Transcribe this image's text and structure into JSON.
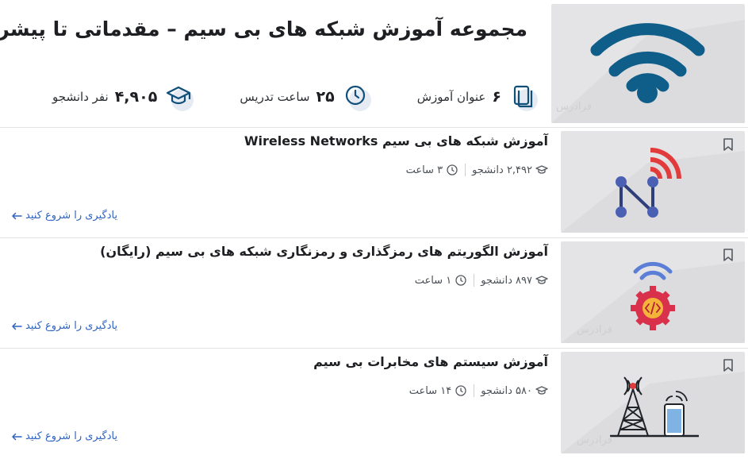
{
  "collection": {
    "title": "مجموعه آموزش شبکه های بی سیم – مقدماتی تا پیشرفته",
    "thumb_icon": "wifi-icon",
    "stats": [
      {
        "icon": "book-icon",
        "value": "۶",
        "label": "عنوان آموزش"
      },
      {
        "icon": "clock-icon",
        "value": "۲۵",
        "label": "ساعت تدریس"
      },
      {
        "icon": "graduation-cap-icon",
        "value": "۴,۹۰۵",
        "label": "نفر دانشجو"
      }
    ],
    "watermark": "فرادرس"
  },
  "courses": [
    {
      "title": "آموزش شبکه های بی سیم Wireless Networks",
      "students": "۲,۴۹۲ دانشجو",
      "hours": "۳ ساعت",
      "cta": "یادگیری را شروع کنید",
      "thumb_icon": "network-signal-icon"
    },
    {
      "title": "آموزش الگوریتم های رمزگذاری و رمزنگاری شبکه های بی سیم (رایگان)",
      "students": "۸۹۷ دانشجو",
      "hours": "۱ ساعت",
      "cta": "یادگیری را شروع کنید",
      "thumb_icon": "code-gear-icon"
    },
    {
      "title": "آموزش سیستم های مخابرات بی سیم",
      "students": "۵۸۰ دانشجو",
      "hours": "۱۴ ساعت",
      "cta": "یادگیری را شروع کنید",
      "thumb_icon": "tower-phone-icon"
    }
  ],
  "colors": {
    "accent": "#2e63c2",
    "wifi": "#0f5e8a",
    "signal_red": "#e23b3b",
    "node_navy": "#2e3f7a"
  }
}
